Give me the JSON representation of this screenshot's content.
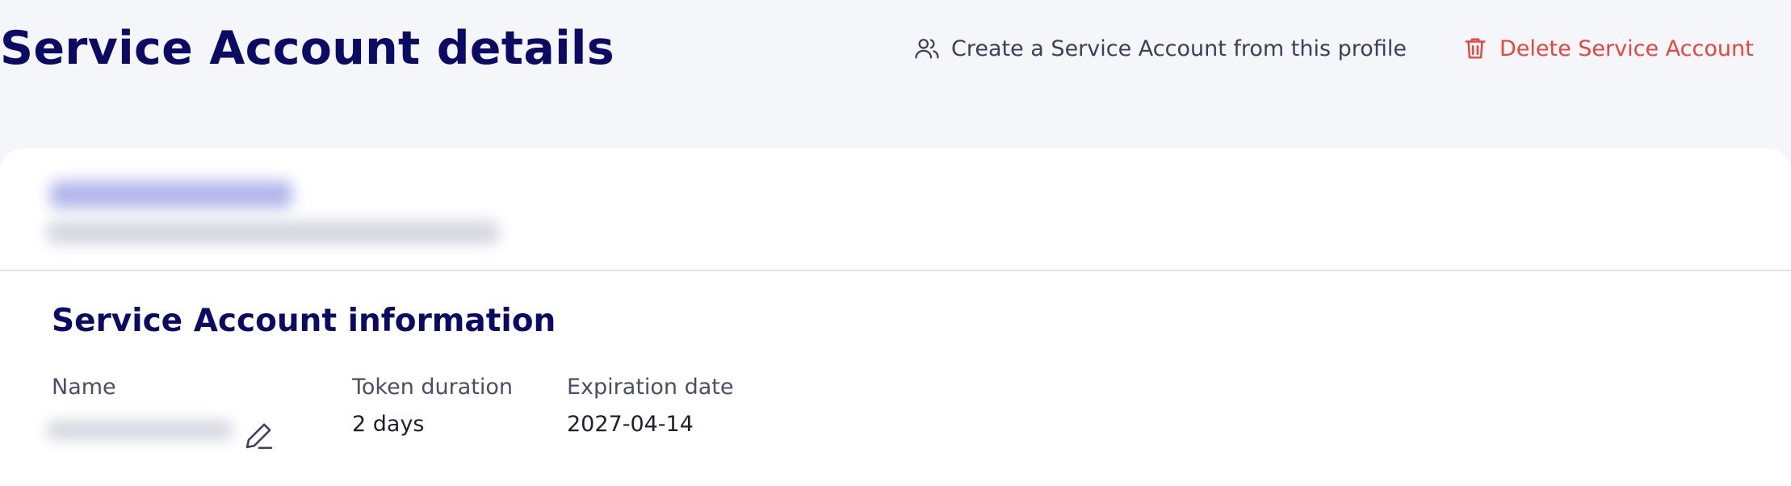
{
  "header": {
    "title": "Service Account details",
    "actions": {
      "create_label": "Create a Service Account from this profile",
      "create_icon": "users-icon",
      "delete_label": "Delete Service Account",
      "delete_icon": "trash-icon"
    }
  },
  "card": {
    "section_title": "Service Account information",
    "fields": {
      "name": {
        "label": "Name",
        "edit_icon": "pencil-icon"
      },
      "token_duration": {
        "label": "Token duration",
        "value": "2 days"
      },
      "expiration_date": {
        "label": "Expiration date",
        "value": "2027-04-14"
      }
    }
  },
  "colors": {
    "title": "#0b0b66",
    "delete": "#e8453c",
    "background": "#f5f6fa",
    "card": "#ffffff"
  }
}
